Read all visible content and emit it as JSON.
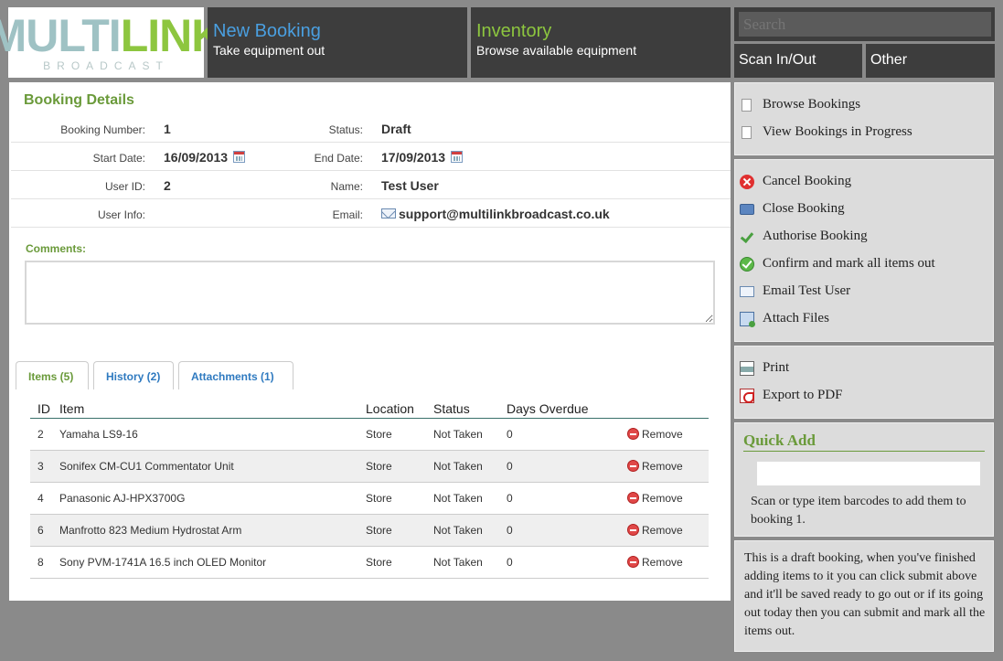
{
  "logo": {
    "main_a": "MULTI",
    "main_b": "LINK",
    "sub": "BROADCAST"
  },
  "nav": {
    "new_booking": {
      "title": "New Booking",
      "subtitle": "Take equipment out"
    },
    "inventory": {
      "title": "Inventory",
      "subtitle": "Browse available equipment"
    },
    "search_placeholder": "Search",
    "scan": "Scan In/Out",
    "other": "Other"
  },
  "booking": {
    "title": "Booking Details",
    "number_label": "Booking Number:",
    "number": "1",
    "status_label": "Status:",
    "status": "Draft",
    "start_label": "Start Date:",
    "start": "16/09/2013",
    "end_label": "End Date:",
    "end": "17/09/2013",
    "userid_label": "User ID:",
    "userid": "2",
    "name_label": "Name:",
    "name": "Test User",
    "userinfo_label": "User Info:",
    "email_label": "Email:",
    "email": "support@multilinkbroadcast.co.uk",
    "comments_label": "Comments:"
  },
  "tabs": {
    "items": "Items (5)",
    "history": "History (2)",
    "attachments": "Attachments (1)"
  },
  "table": {
    "headers": {
      "id": "ID",
      "item": "Item",
      "location": "Location",
      "status": "Status",
      "days": "Days Overdue"
    },
    "remove_label": "Remove",
    "rows": [
      {
        "id": "2",
        "item": "Yamaha LS9-16",
        "location": "Store",
        "status": "Not Taken",
        "days": "0"
      },
      {
        "id": "3",
        "item": "Sonifex CM-CU1 Commentator Unit",
        "location": "Store",
        "status": "Not Taken",
        "days": "0"
      },
      {
        "id": "4",
        "item": "Panasonic AJ-HPX3700G",
        "location": "Store",
        "status": "Not Taken",
        "days": "0"
      },
      {
        "id": "6",
        "item": "Manfrotto 823 Medium Hydrostat Arm",
        "location": "Store",
        "status": "Not Taken",
        "days": "0"
      },
      {
        "id": "8",
        "item": "Sony PVM-1741A 16.5 inch OLED Monitor",
        "location": "Store",
        "status": "Not Taken",
        "days": "0"
      }
    ]
  },
  "sidebar": {
    "browse": "Browse Bookings",
    "in_progress": "View Bookings in Progress",
    "cancel": "Cancel Booking",
    "close": "Close Booking",
    "authorise": "Authorise Booking",
    "confirm": "Confirm and mark all items out",
    "email": "Email Test User",
    "attach": "Attach Files",
    "print": "Print",
    "pdf": "Export to PDF",
    "quick_add_title": "Quick Add",
    "quick_add_help": "Scan or type item barcodes to add them to booking 1.",
    "draft_note": "This is a draft booking, when you've finished adding items to it you can click submit above and it'll be saved ready to go out or if its going out today then you can submit and mark all the items out."
  }
}
